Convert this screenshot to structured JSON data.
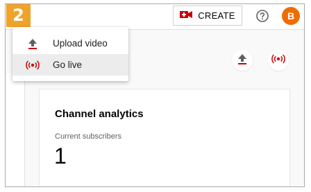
{
  "step_badge": "2",
  "header": {
    "create_label": "CREATE",
    "avatar_letter": "B"
  },
  "create_menu": {
    "items": [
      {
        "label": "Upload video",
        "icon": "upload-icon",
        "highlighted": false
      },
      {
        "label": "Go live",
        "icon": "live-icon",
        "highlighted": true
      }
    ]
  },
  "channel_analytics": {
    "title": "Channel analytics",
    "subscribers_label": "Current subscribers",
    "subscribers_value": "1"
  },
  "colors": {
    "badge": "#f0a32b",
    "accent_red": "#cc0000",
    "avatar": "#ef6c00"
  }
}
